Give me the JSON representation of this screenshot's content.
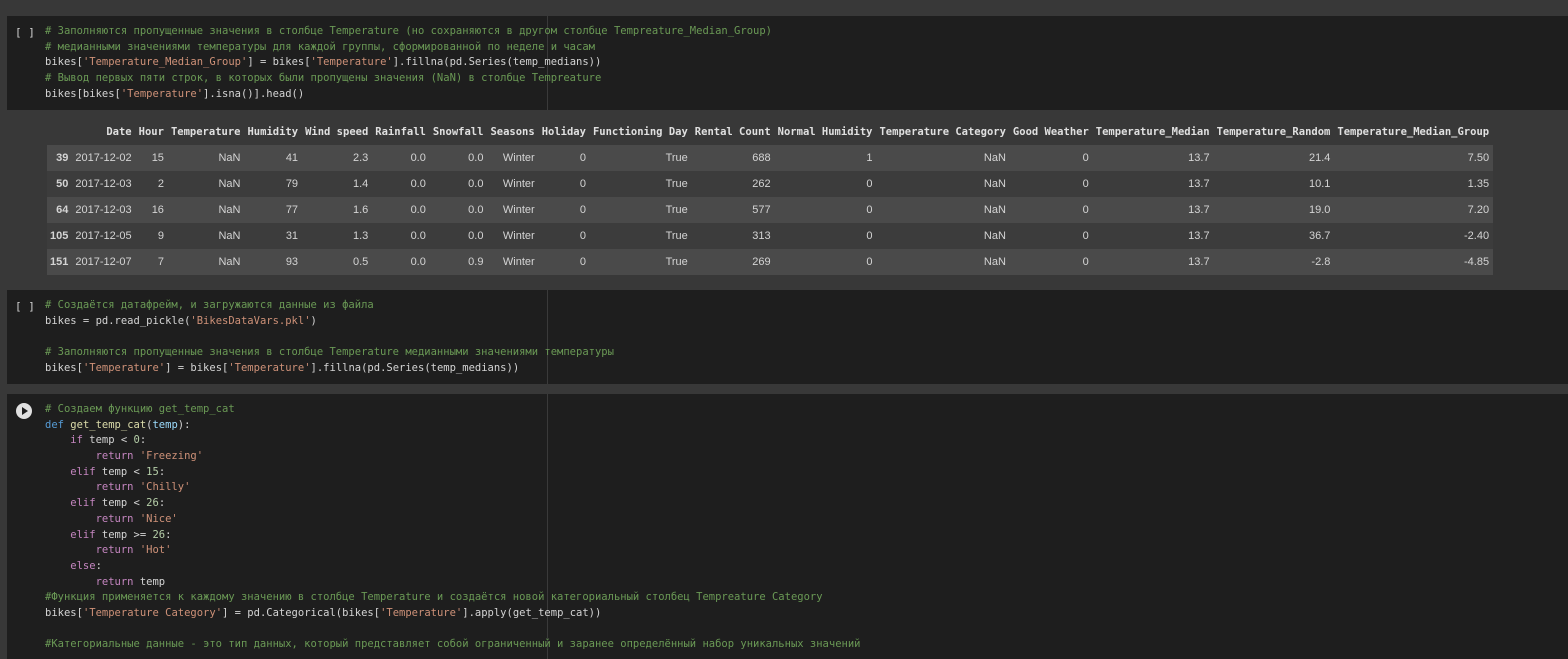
{
  "cell1": {
    "bracket": "[ ]",
    "lines": [
      [
        {
          "t": "# Заполняются пропущенные значения в столбце Temperature (но сохраняются в другом столбце Tempreature_Median_Group)",
          "c": "c-comment"
        }
      ],
      [
        {
          "t": "# медианными значениями температуры для каждой группы, сформированной по неделе и часам",
          "c": "c-comment"
        }
      ],
      [
        {
          "t": "bikes[",
          "c": ""
        },
        {
          "t": "'Temperature_Median_Group'",
          "c": "c-str"
        },
        {
          "t": "] = bikes[",
          "c": ""
        },
        {
          "t": "'Temperature'",
          "c": "c-str"
        },
        {
          "t": "].fillna(pd.Series(temp_medians))",
          "c": ""
        }
      ],
      [
        {
          "t": "# Вывод первых пяти строк, в которых были пропущены значения (NaN) в столбце Tempreature",
          "c": "c-comment"
        }
      ],
      [
        {
          "t": "bikes[bikes[",
          "c": ""
        },
        {
          "t": "'Temperature'",
          "c": "c-str"
        },
        {
          "t": "].isna()].head()",
          "c": ""
        }
      ]
    ]
  },
  "table": {
    "headers": [
      "",
      "Date",
      "Hour",
      "Temperature",
      "Humidity",
      "Wind speed",
      "Rainfall",
      "Snowfall",
      "Seasons",
      "Holiday",
      "Functioning Day",
      "Rental Count",
      "Normal Humidity",
      "Temperature Category",
      "Good Weather",
      "Temperature_Median",
      "Temperature_Random",
      "Temperature_Median_Group"
    ],
    "rows": [
      [
        "39",
        "2017-12-02",
        "15",
        "NaN",
        "41",
        "2.3",
        "0.0",
        "0.0",
        "Winter",
        "0",
        "True",
        "688",
        "1",
        "NaN",
        "0",
        "13.7",
        "21.4",
        "7.50"
      ],
      [
        "50",
        "2017-12-03",
        "2",
        "NaN",
        "79",
        "1.4",
        "0.0",
        "0.0",
        "Winter",
        "0",
        "True",
        "262",
        "0",
        "NaN",
        "0",
        "13.7",
        "10.1",
        "1.35"
      ],
      [
        "64",
        "2017-12-03",
        "16",
        "NaN",
        "77",
        "1.6",
        "0.0",
        "0.0",
        "Winter",
        "0",
        "True",
        "577",
        "0",
        "NaN",
        "0",
        "13.7",
        "19.0",
        "7.20"
      ],
      [
        "105",
        "2017-12-05",
        "9",
        "NaN",
        "31",
        "1.3",
        "0.0",
        "0.0",
        "Winter",
        "0",
        "True",
        "313",
        "0",
        "NaN",
        "0",
        "13.7",
        "36.7",
        "-2.40"
      ],
      [
        "151",
        "2017-12-07",
        "7",
        "NaN",
        "93",
        "0.5",
        "0.0",
        "0.9",
        "Winter",
        "0",
        "True",
        "269",
        "0",
        "NaN",
        "0",
        "13.7",
        "-2.8",
        "-4.85"
      ]
    ]
  },
  "cell2": {
    "bracket": "[ ]",
    "lines": [
      [
        {
          "t": "# Создаётся датафрейм, и загружаются данные из файла",
          "c": "c-comment"
        }
      ],
      [
        {
          "t": "bikes = pd.read_pickle(",
          "c": ""
        },
        {
          "t": "'BikesDataVars.pkl'",
          "c": "c-str"
        },
        {
          "t": ")",
          "c": ""
        }
      ],
      [
        {
          "t": "",
          "c": ""
        }
      ],
      [
        {
          "t": "# Заполняются пропущенные значения в столбце Temperature медианными значениями температуры",
          "c": "c-comment"
        }
      ],
      [
        {
          "t": "bikes[",
          "c": ""
        },
        {
          "t": "'Temperature'",
          "c": "c-str"
        },
        {
          "t": "] = bikes[",
          "c": ""
        },
        {
          "t": "'Temperature'",
          "c": "c-str"
        },
        {
          "t": "].fillna(pd.Series(temp_medians))",
          "c": ""
        }
      ]
    ]
  },
  "cell3": {
    "lines": [
      [
        {
          "t": "# Создаем функцию get_temp_cat",
          "c": "c-comment"
        }
      ],
      [
        {
          "t": "def ",
          "c": "c-kw"
        },
        {
          "t": "get_temp_cat",
          "c": "c-fn"
        },
        {
          "t": "(",
          "c": ""
        },
        {
          "t": "temp",
          "c": "c-var"
        },
        {
          "t": "):",
          "c": ""
        }
      ],
      [
        {
          "t": "    if ",
          "c": "c-ctl"
        },
        {
          "t": "temp < ",
          "c": ""
        },
        {
          "t": "0",
          "c": "c-num"
        },
        {
          "t": ":",
          "c": ""
        }
      ],
      [
        {
          "t": "        return ",
          "c": "c-ctl"
        },
        {
          "t": "'Freezing'",
          "c": "c-str"
        }
      ],
      [
        {
          "t": "    elif ",
          "c": "c-ctl"
        },
        {
          "t": "temp < ",
          "c": ""
        },
        {
          "t": "15",
          "c": "c-num"
        },
        {
          "t": ":",
          "c": ""
        }
      ],
      [
        {
          "t": "        return ",
          "c": "c-ctl"
        },
        {
          "t": "'Chilly'",
          "c": "c-str"
        }
      ],
      [
        {
          "t": "    elif ",
          "c": "c-ctl"
        },
        {
          "t": "temp < ",
          "c": ""
        },
        {
          "t": "26",
          "c": "c-num"
        },
        {
          "t": ":",
          "c": ""
        }
      ],
      [
        {
          "t": "        return ",
          "c": "c-ctl"
        },
        {
          "t": "'Nice'",
          "c": "c-str"
        }
      ],
      [
        {
          "t": "    elif ",
          "c": "c-ctl"
        },
        {
          "t": "temp >= ",
          "c": ""
        },
        {
          "t": "26",
          "c": "c-num"
        },
        {
          "t": ":",
          "c": ""
        }
      ],
      [
        {
          "t": "        return ",
          "c": "c-ctl"
        },
        {
          "t": "'Hot'",
          "c": "c-str"
        }
      ],
      [
        {
          "t": "    else",
          "c": "c-ctl"
        },
        {
          "t": ":",
          "c": ""
        }
      ],
      [
        {
          "t": "        return ",
          "c": "c-ctl"
        },
        {
          "t": "temp",
          "c": ""
        }
      ],
      [
        {
          "t": "#Функция применяется к каждому значению в столбце Temperature и создаётся новой категориальный столбец Tempreature Category",
          "c": "c-comment"
        }
      ],
      [
        {
          "t": "bikes[",
          "c": ""
        },
        {
          "t": "'Temperature Category'",
          "c": "c-str"
        },
        {
          "t": "] = pd.Categorical(bikes[",
          "c": ""
        },
        {
          "t": "'Temperature'",
          "c": "c-str"
        },
        {
          "t": "].apply(get_temp_cat))",
          "c": ""
        }
      ],
      [
        {
          "t": "",
          "c": ""
        }
      ],
      [
        {
          "t": "#Категориальные данные - это тип данных, который представляет собой ограниченный и заранее определённый набор уникальных значений",
          "c": "c-comment"
        }
      ]
    ]
  }
}
